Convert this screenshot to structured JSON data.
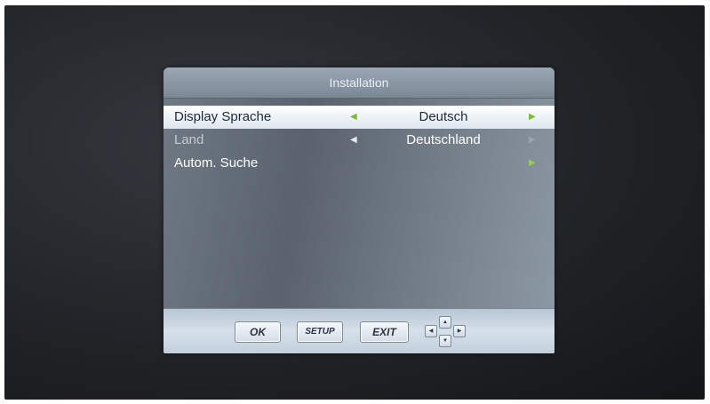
{
  "dialog": {
    "title": "Installation"
  },
  "menu": {
    "items": [
      {
        "label": "Display Sprache",
        "value": "Deutsch",
        "left_arrow": "◀",
        "right_arrow": "▶"
      },
      {
        "label": "Land",
        "value": "Deutschland",
        "left_arrow": "◀",
        "right_arrow": "▶"
      },
      {
        "label": "Autom. Suche",
        "value": "",
        "left_arrow": "",
        "right_arrow": "▶"
      }
    ],
    "selected_index": 0
  },
  "footer": {
    "ok_label": "OK",
    "setup_label": "SETUP",
    "exit_label": "EXIT",
    "dpad": {
      "up": "▲",
      "down": "▼",
      "left": "◀",
      "right": "▶"
    }
  },
  "colors": {
    "accent_arrow": "#8fd14a",
    "selected_row": "#ffffff"
  }
}
